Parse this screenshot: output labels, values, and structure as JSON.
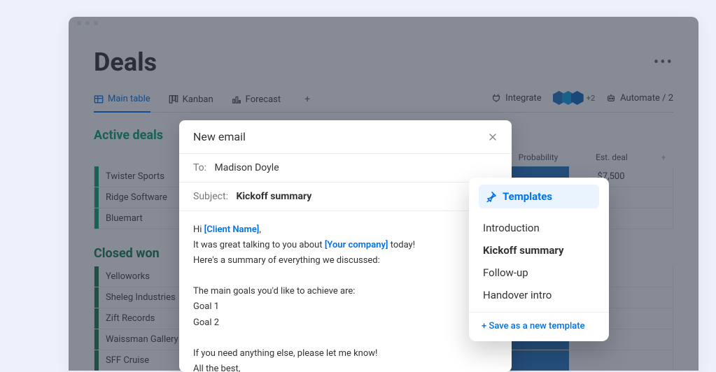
{
  "page": {
    "title": "Deals"
  },
  "tabs": [
    {
      "label": "Main table",
      "icon": "table-icon",
      "active": true
    },
    {
      "label": "Kanban",
      "icon": "kanban-icon"
    },
    {
      "label": "Forecast",
      "icon": "chart-icon"
    }
  ],
  "toolbarRight": {
    "integrate": "Integrate",
    "integrationsExtra": "+2",
    "automate": "Automate / 2"
  },
  "columns": {
    "probability": "Probability",
    "estDeal": "Est. deal"
  },
  "groups": {
    "active": {
      "title": "Active deals",
      "rows": [
        {
          "name": "Twister Sports",
          "est": "$7,500"
        },
        {
          "name": "Ridge Software"
        },
        {
          "name": "Bluemart"
        }
      ]
    },
    "closed": {
      "title": "Closed won",
      "rows": [
        {
          "name": "Yelloworks"
        },
        {
          "name": "Sheleg Industries"
        },
        {
          "name": "Zift Records"
        },
        {
          "name": "Waissman Gallery"
        },
        {
          "name": "SFF Cruise"
        }
      ]
    }
  },
  "modal": {
    "title": "New email",
    "toLabel": "To:",
    "toValue": "Madison Doyle",
    "subjectLabel": "Subject:",
    "subjectValue": "Kickoff summary",
    "body": {
      "greeting_pre": "Hi ",
      "ph_client": "[Client Name]",
      "greeting_post": ",",
      "line2a": "It was great talking to you about ",
      "ph_company": "[Your company]",
      "line2b": " today!",
      "line3": "Here's a summary of everything we discussed:",
      "line4": "The main goals you'd like to achieve are:",
      "goal1": "Goal 1",
      "goal2": "Goal 2",
      "line5": "If you need anything else, please let me know!",
      "line6": "All the best,"
    }
  },
  "templates": {
    "header": "Templates",
    "items": [
      "Introduction",
      "Kickoff summary",
      "Follow-up",
      "Handover intro"
    ],
    "selectedIndex": 1,
    "saveNew": "+ Save as a new template"
  }
}
